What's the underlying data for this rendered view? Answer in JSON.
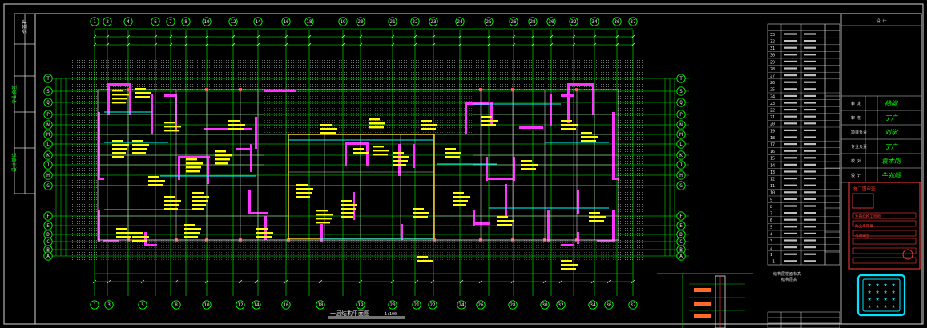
{
  "colors": {
    "background": "#000000",
    "frame": "#e8e8e8",
    "axis": "#00ff00",
    "bubble": "#00ff00",
    "wall": "#ff33ff",
    "beam": "#00ffff",
    "label": "#ffff00",
    "hatch": "#888888",
    "stamp": "#ff3b3b",
    "logo": "#00e5ff"
  },
  "drawing": {
    "plan_title": "一层结构平面图",
    "scale": "1:100",
    "axes_top": [
      "1",
      "2",
      "4",
      "6",
      "7",
      "8",
      "10",
      "12",
      "14",
      "16",
      "18",
      "19",
      "20",
      "21",
      "22",
      "23",
      "24",
      "25",
      "26",
      "28",
      "30",
      "32",
      "34",
      "36",
      "37"
    ],
    "axes_bottom": [
      "1",
      "3",
      "5",
      "8",
      "10",
      "12",
      "14",
      "16",
      "18",
      "19",
      "20",
      "21",
      "22",
      "24",
      "26",
      "28",
      "30",
      "32",
      "34",
      "36",
      "37"
    ],
    "axes_left": [
      "T",
      "S",
      "Q",
      "P",
      "N",
      "M",
      "L",
      "K",
      "J",
      "H",
      "G",
      "F",
      "E",
      "D",
      "C",
      "B",
      "A"
    ],
    "axes_right": [
      "T",
      "S",
      "Q",
      "P",
      "N",
      "M",
      "L",
      "K",
      "J",
      "H",
      "G",
      "F",
      "E",
      "D",
      "C",
      "B",
      "A"
    ]
  },
  "legend_table": {
    "caption": "结构层楼面标高",
    "subcaption": "结构层高",
    "floor_rows": [
      "33",
      "32",
      "31",
      "30",
      "29",
      "28",
      "27",
      "26",
      "25",
      "24",
      "23",
      "22",
      "21",
      "20",
      "19",
      "18",
      "17",
      "16",
      "15",
      "14",
      "13",
      "12",
      "11",
      "10",
      "9",
      "8",
      "7",
      "6",
      "5",
      "4",
      "3",
      "2",
      "1",
      "-1"
    ]
  },
  "title_block": {
    "header": "设 计",
    "roles": [
      "审 定",
      "审 核",
      "项目负责",
      "专业负责",
      "校 对",
      "设 计"
    ],
    "names": [
      "杨柳",
      "丁广",
      "刘学",
      "丁广",
      "袁本刚",
      "牛兆顺"
    ],
    "stamp_title": "施工图审查",
    "stamp_lines": [
      "注册结构工程师",
      "执业专用章",
      "有效期至"
    ]
  }
}
